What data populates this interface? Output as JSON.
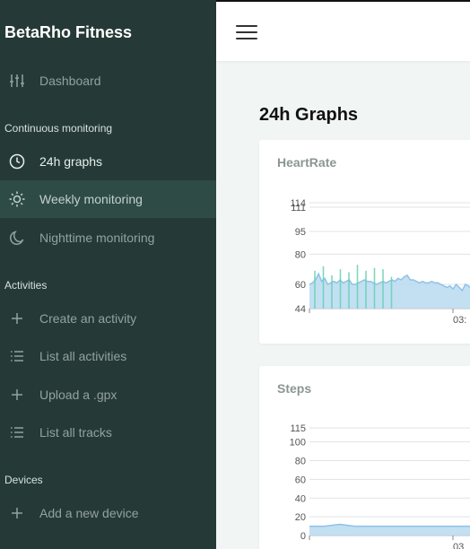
{
  "app": {
    "brand": "BetaRho Fitness"
  },
  "sidebar": {
    "items_top": [
      {
        "label": "Dashboard",
        "icon": "sliders-icon"
      }
    ],
    "sections": [
      {
        "title": "Continuous monitoring",
        "items": [
          {
            "label": "24h graphs",
            "icon": "clock-icon",
            "state": "active"
          },
          {
            "label": "Weekly monitoring",
            "icon": "sun-icon",
            "state": "hover"
          },
          {
            "label": "Nighttime monitoring",
            "icon": "moon-icon"
          }
        ]
      },
      {
        "title": "Activities",
        "items": [
          {
            "label": "Create an activity",
            "icon": "plus-icon"
          },
          {
            "label": "List all activities",
            "icon": "list-icon"
          },
          {
            "label": "Upload a .gpx",
            "icon": "plus-icon"
          },
          {
            "label": "List all tracks",
            "icon": "list-icon"
          }
        ]
      },
      {
        "title": "Devices",
        "items": [
          {
            "label": "Add a new device",
            "icon": "plus-icon"
          }
        ]
      }
    ]
  },
  "topbar": {
    "menu_icon": "hamburger-icon"
  },
  "main": {
    "title": "24h Graphs"
  },
  "colors": {
    "sidebar_bg": "#253a36",
    "fill": "#b9d9f0",
    "line": "#8fc2e8",
    "accent": "#66d1b0"
  },
  "chart_data": [
    {
      "type": "area",
      "title": "HeartRate",
      "yticks": [
        44,
        60,
        80,
        95,
        111,
        114
      ],
      "ylim": [
        44,
        114
      ],
      "xticks": [
        "03:"
      ],
      "series": [
        {
          "values": [
            60,
            61,
            63,
            67,
            62,
            64,
            60,
            61,
            62,
            61,
            63,
            61,
            62,
            63,
            60,
            60,
            61,
            62,
            63,
            62,
            62,
            61,
            60,
            61,
            62,
            61,
            62,
            63,
            62,
            64,
            63,
            65,
            66,
            63,
            63,
            62,
            61,
            62,
            61,
            61,
            62,
            61,
            61,
            60,
            59,
            58,
            59,
            57,
            60,
            58,
            56,
            60,
            59,
            57,
            58
          ]
        }
      ],
      "markers": [
        69,
        72,
        66,
        70,
        68,
        73,
        69,
        71,
        70,
        65
      ]
    },
    {
      "type": "area",
      "title": "Steps",
      "yticks": [
        0,
        20,
        40,
        60,
        80,
        100,
        115
      ],
      "ylim": [
        0,
        115
      ],
      "xticks": [
        "03"
      ],
      "series": [
        {
          "values": [
            10,
            10,
            12,
            10,
            10,
            10,
            10,
            10,
            10,
            10,
            10,
            10
          ]
        }
      ]
    }
  ]
}
